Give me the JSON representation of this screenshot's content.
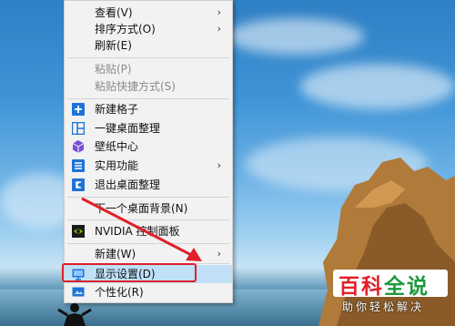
{
  "menu": {
    "items": [
      {
        "label": "查看(V)",
        "submenu": true
      },
      {
        "label": "排序方式(O)",
        "submenu": true
      },
      {
        "label": "刷新(E)"
      },
      {
        "label": "粘贴(P)",
        "disabled": true
      },
      {
        "label": "粘贴快捷方式(S)",
        "disabled": true
      },
      {
        "label": "新建格子",
        "icon": "plus-icon"
      },
      {
        "label": "一键桌面整理",
        "icon": "layout-icon"
      },
      {
        "label": "壁纸中心",
        "icon": "cube-icon"
      },
      {
        "label": "实用功能",
        "icon": "list-icon",
        "submenu": true
      },
      {
        "label": "退出桌面整理",
        "icon": "exit-icon"
      },
      {
        "label": "下一个桌面背景(N)"
      },
      {
        "label": "NVIDIA 控制面板",
        "icon": "nvidia-icon"
      },
      {
        "label": "新建(W)",
        "submenu": true
      },
      {
        "label": "显示设置(D)",
        "icon": "display-icon",
        "highlight": true
      },
      {
        "label": "个性化(R)",
        "icon": "personalize-icon"
      }
    ]
  },
  "watermark": {
    "title_chars": [
      "百",
      "科",
      "全",
      "说"
    ],
    "subtitle": "助你轻松解决"
  },
  "colors": {
    "menu_bg": "#f2f2f2",
    "highlight": "#bfe0f7",
    "annotation_red": "#e0202a",
    "icon_blue": "#1e73d6",
    "nvidia_green": "#76b900"
  }
}
